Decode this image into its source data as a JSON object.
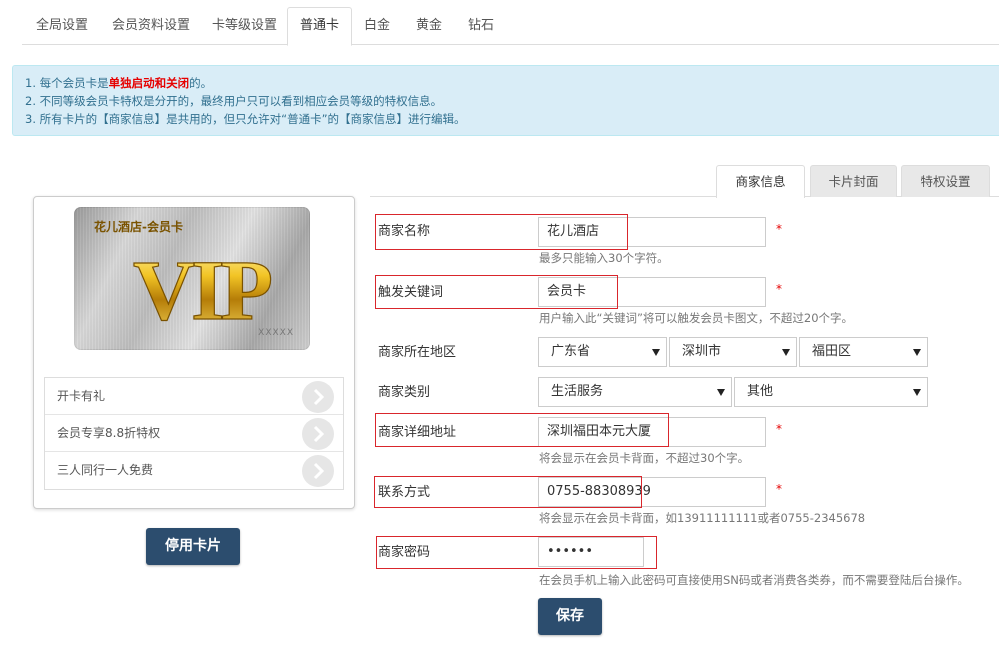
{
  "top_tabs": [
    {
      "label": "全局设置"
    },
    {
      "label": "会员资料设置"
    },
    {
      "label": "卡等级设置"
    },
    {
      "label": "普通卡"
    },
    {
      "label": "白金"
    },
    {
      "label": "黄金"
    },
    {
      "label": "钻石"
    }
  ],
  "active_top_tab": "普通卡",
  "notice": {
    "line1_prefix": "1. 每个会员卡是",
    "line1_highlight": "单独启动和关闭",
    "line1_suffix": "的。",
    "line2": "2. 不同等级会员卡特权是分开的，最终用户只可以看到相应会员等级的特权信息。",
    "line3": "3. 所有卡片的【商家信息】是共用的，但只允许对“普通卡”的【商家信息】进行编辑。"
  },
  "card": {
    "name": "花儿酒店-会员卡",
    "logo_text": "VIP",
    "number_mask": "XXXXX",
    "benefits": [
      {
        "label": "开卡有礼"
      },
      {
        "label": "会员专享8.8折特权"
      },
      {
        "label": "三人同行一人免费"
      }
    ],
    "stop_button": "停用卡片"
  },
  "side_tabs": [
    {
      "label": "商家信息"
    },
    {
      "label": "卡片封面"
    },
    {
      "label": "特权设置"
    }
  ],
  "active_side_tab": "商家信息",
  "form": {
    "merchant_name": {
      "label": "商家名称",
      "value": "花儿酒店",
      "help": "最多只能输入30个字符。",
      "required": "*"
    },
    "keyword": {
      "label": "触发关键词",
      "value": "会员卡",
      "help": "用户输入此“关键词”将可以触发会员卡图文，不超过20个字。",
      "required": "*"
    },
    "region": {
      "label": "商家所在地区",
      "province": "广东省",
      "city": "深圳市",
      "district": "福田区"
    },
    "category": {
      "label": "商家类别",
      "primary": "生活服务",
      "secondary": "其他"
    },
    "address": {
      "label": "商家详细地址",
      "value": "深圳福田本元大厦",
      "help": "将会显示在会员卡背面，不超过30个字。",
      "required": "*"
    },
    "contact": {
      "label": "联系方式",
      "value": "0755-88308939",
      "help": "将会显示在会员卡背面，如13911111111或者0755-2345678",
      "required": "*"
    },
    "password": {
      "label": "商家密码",
      "value": "••••••",
      "help": "在会员手机上输入此密码可直接使用SN码或者消费各类券，而不需要登陆后台操作。"
    },
    "save_button": "保存"
  },
  "colors": {
    "primary_button": "#2c4d6e",
    "notice_bg": "#d9edf7",
    "notice_text": "#31708f",
    "highlight": "#e60000",
    "annotation_box": "#d9262c"
  }
}
